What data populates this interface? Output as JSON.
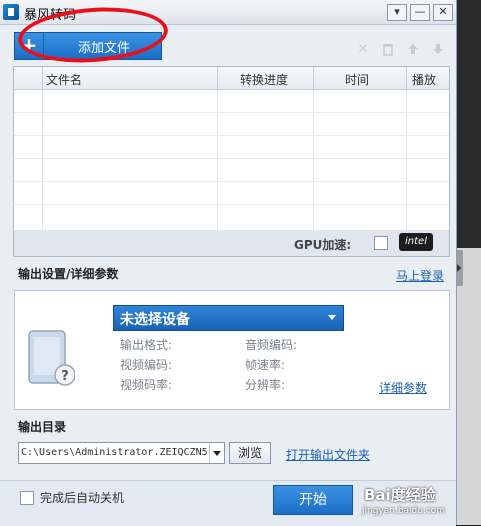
{
  "window": {
    "title": "暴风转码",
    "controls": {
      "menu": "▾",
      "minimize": "—",
      "close": "✕"
    }
  },
  "toolbar": {
    "add_icon": "+",
    "add_label": "添加文件",
    "icons": [
      "delete-icon",
      "trash-icon",
      "move-up-icon",
      "move-down-icon"
    ]
  },
  "file_table": {
    "columns": [
      "文件名",
      "转换进度",
      "时间",
      "播放"
    ],
    "rows": []
  },
  "gpu": {
    "label": "GPU加速:",
    "badge": "intel"
  },
  "settings": {
    "title": "输出设置/详细参数",
    "login_link": "马上登录",
    "device": "未选择设备",
    "params": [
      "输出格式:",
      "音频编码:",
      "视频编码:",
      "帧速率:",
      "视频码率:",
      "分辨率:"
    ],
    "detail_link": "详细参数"
  },
  "output": {
    "title": "输出目录",
    "path": "C:\\Users\\Administrator.ZEIQCZN5",
    "browse": "浏览",
    "open_folder": "打开输出文件夹"
  },
  "footer": {
    "shutdown_label": "完成后自动关机",
    "start": "开始"
  },
  "watermark": {
    "brand": "Bai度经验",
    "url": "jingyan.baidu.com"
  },
  "colors": {
    "accent": "#1c6ec6",
    "link": "#1a5fb4",
    "annotation": "#e8101a"
  }
}
